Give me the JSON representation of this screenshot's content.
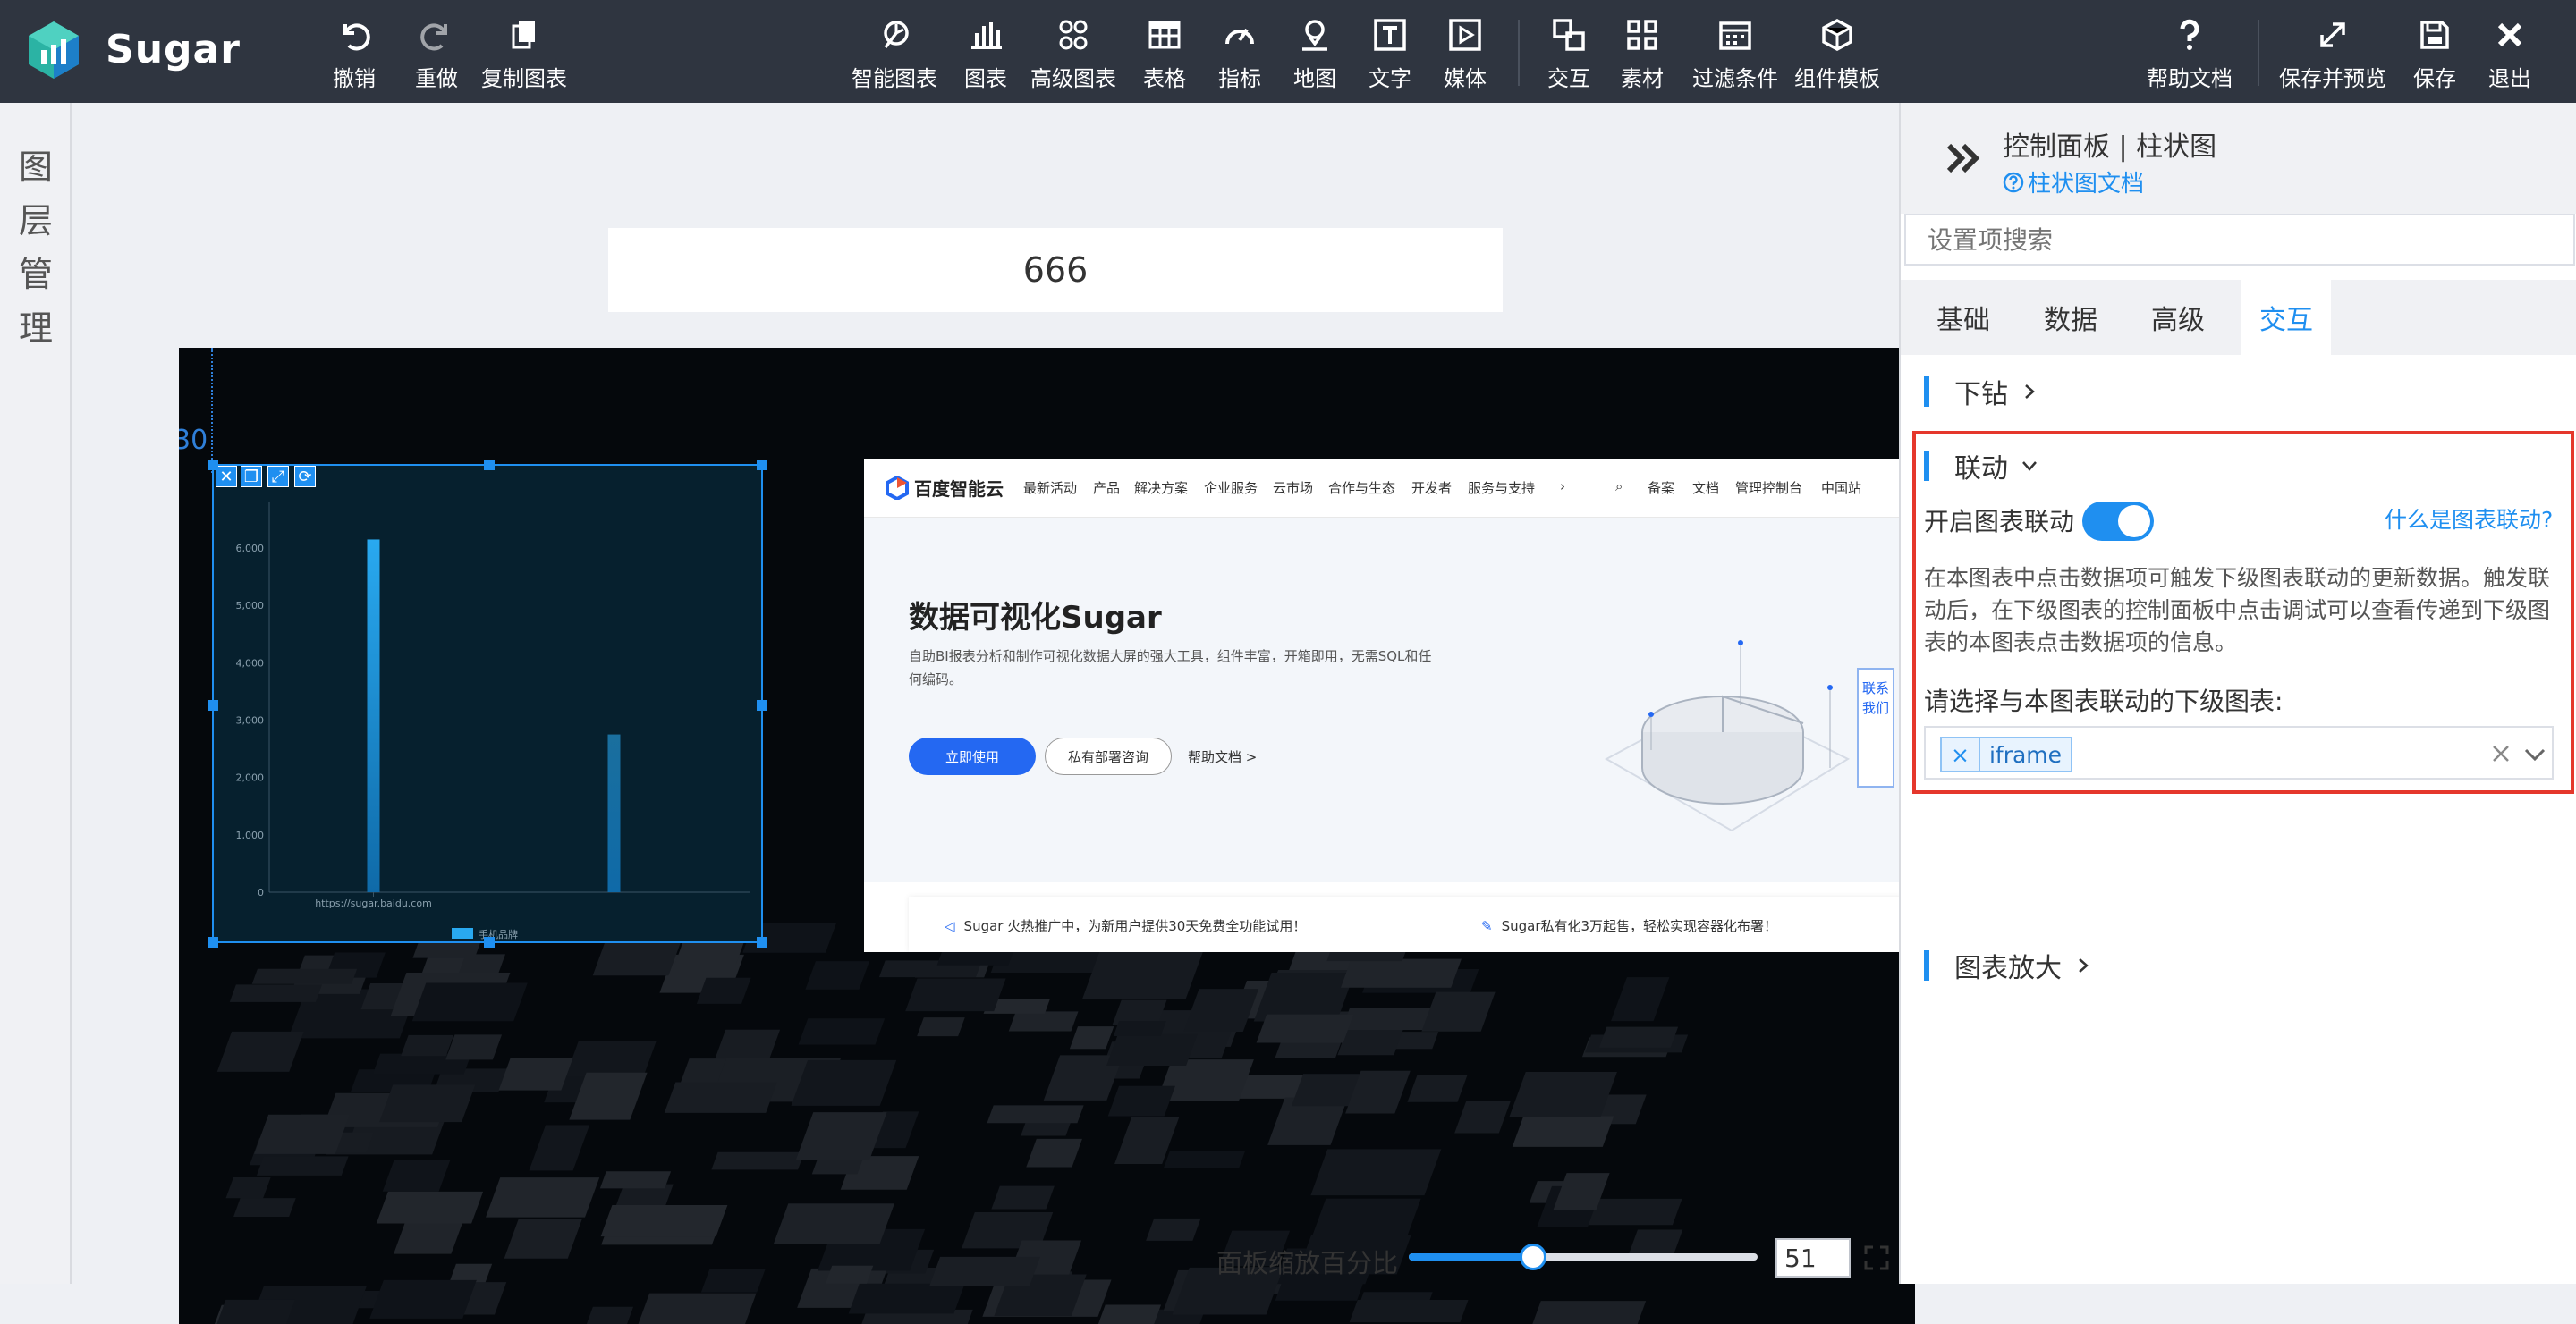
{
  "app": {
    "name": "Sugar"
  },
  "toolbar": {
    "undo": "撤销",
    "redo": "重做",
    "copy_chart": "复制图表",
    "smart_chart": "智能图表",
    "chart": "图表",
    "advanced_chart": "高级图表",
    "table": "表格",
    "metric": "指标",
    "map": "地图",
    "text": "文字",
    "media": "媒体",
    "interaction": "交互",
    "assets": "素材",
    "filter": "过滤条件",
    "component_template": "组件模板",
    "help_doc": "帮助文档",
    "save_preview": "保存并预览",
    "save": "保存",
    "exit": "退出"
  },
  "layer_panel": {
    "label": "图层管理"
  },
  "canvas": {
    "title_text": "666",
    "guide_number": "30",
    "zoom": {
      "label": "面板缩放百分比",
      "value": "51",
      "fraction": 0.51
    }
  },
  "chart_data": {
    "type": "bar",
    "categories": [
      "https://sugar.baidu.com",
      ""
    ],
    "series": [
      {
        "name": "手机品牌",
        "values": [
          6150,
          2750
        ]
      }
    ],
    "yticks": [
      "0",
      "1,000",
      "2,000",
      "3,000",
      "4,000",
      "5,000",
      "6,000"
    ],
    "ylim": [
      0,
      6500
    ],
    "title": "",
    "xlabel": "",
    "ylabel": "",
    "colors": [
      "#29a9f0",
      "#1a6f9e"
    ],
    "legend": "bottom"
  },
  "iframe_site": {
    "brand": "百度智能云",
    "nav": [
      "最新活动",
      "产品",
      "解决方案",
      "企业服务",
      "云市场",
      "合作与生态",
      "开发者",
      "服务与支持"
    ],
    "nav_right": [
      "备案",
      "文档",
      "管理控制台",
      "中国站"
    ],
    "hero_title": "数据可视化Sugar",
    "hero_desc": "自助BI报表分析和制作可视化数据大屏的强大工具，组件丰富，开箱即用，无需SQL和任何编码。",
    "btn_use": "立即使用",
    "btn_consult": "私有部署咨询",
    "help_link": "帮助文档 >",
    "contact": "联系我们",
    "notice1": "Sugar 火热推广中，为新用户提供30天免费全功能试用！",
    "notice2": "Sugar私有化3万起售，轻松实现容器化布署！"
  },
  "control_panel": {
    "title": "控制面板 | 柱状图",
    "doc_link": "柱状图文档",
    "search_placeholder": "设置项搜索",
    "tabs": [
      {
        "label": "基础",
        "active": false
      },
      {
        "label": "数据",
        "active": false
      },
      {
        "label": "高级",
        "active": false
      },
      {
        "label": "交互",
        "active": true
      }
    ],
    "drilldown": "下钻",
    "linkage": {
      "title": "联动",
      "toggle_label": "开启图表联动",
      "toggle_on": true,
      "what_link": "什么是图表联动?",
      "description": "在本图表中点击数据项可触发下级图表联动的更新数据。触发联动后，在下级图表的控制面板中点击调试可以查看传递到下级图表的本图表点击数据项的信息。",
      "select_label": "请选择与本图表联动的下级图表:",
      "selected_tags": [
        "iframe"
      ]
    },
    "chart_zoom": "图表放大"
  },
  "colors": {
    "accent": "#1f8ff0",
    "topbar": "#2f3540",
    "highlight_border": "#e5372c"
  }
}
